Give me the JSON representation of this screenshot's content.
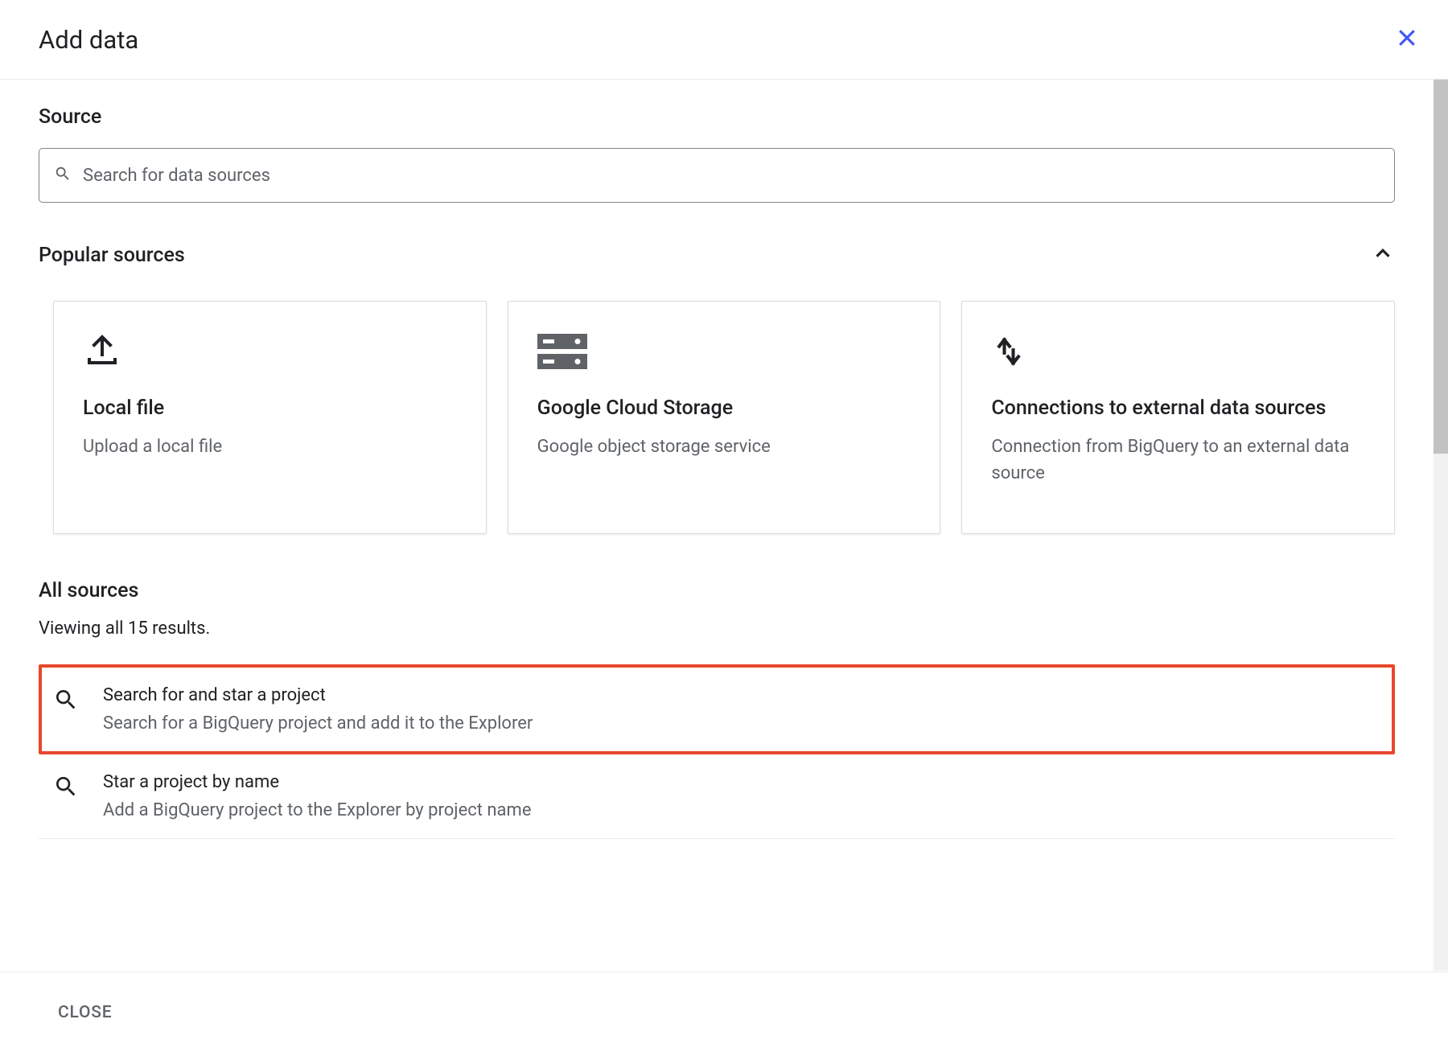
{
  "header": {
    "title": "Add data"
  },
  "source": {
    "label": "Source",
    "search_placeholder": "Search for data sources"
  },
  "popular": {
    "label": "Popular sources",
    "cards": [
      {
        "title": "Local file",
        "desc": "Upload a local file",
        "icon": "upload"
      },
      {
        "title": "Google Cloud Storage",
        "desc": "Google object storage service",
        "icon": "storage"
      },
      {
        "title": "Connections to external data sources",
        "desc": "Connection from BigQuery to an external data source",
        "icon": "sync"
      }
    ]
  },
  "all_sources": {
    "label": "All sources",
    "viewing_text": "Viewing all 15 results.",
    "items": [
      {
        "title": "Search for and star a project",
        "desc": "Search for a BigQuery project and add it to the Explorer",
        "highlighted": true
      },
      {
        "title": "Star a project by name",
        "desc": "Add a BigQuery project to the Explorer by project name",
        "highlighted": false
      }
    ]
  },
  "footer": {
    "close_label": "CLOSE"
  }
}
